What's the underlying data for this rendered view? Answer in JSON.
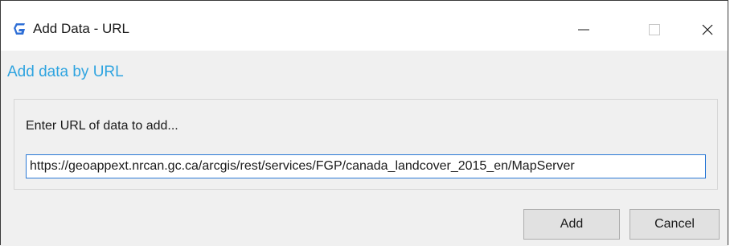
{
  "window": {
    "title": "Add Data - URL",
    "app_icon": "geocortex-g-icon",
    "controls": {
      "minimize": "minimize-icon",
      "maximize": "maximize-icon",
      "close": "close-icon"
    }
  },
  "dialog": {
    "heading": "Add data by URL",
    "prompt": "Enter URL of data to add...",
    "url_value": "https://geoappext.nrcan.gc.ca/arcgis/rest/services/FGP/canada_landcover_2015_en/MapServer",
    "buttons": {
      "add": "Add",
      "cancel": "Cancel"
    }
  },
  "colors": {
    "heading_accent": "#2fa4e0",
    "input_focus_border": "#2b79d6",
    "app_icon": "#2f6fd6"
  }
}
